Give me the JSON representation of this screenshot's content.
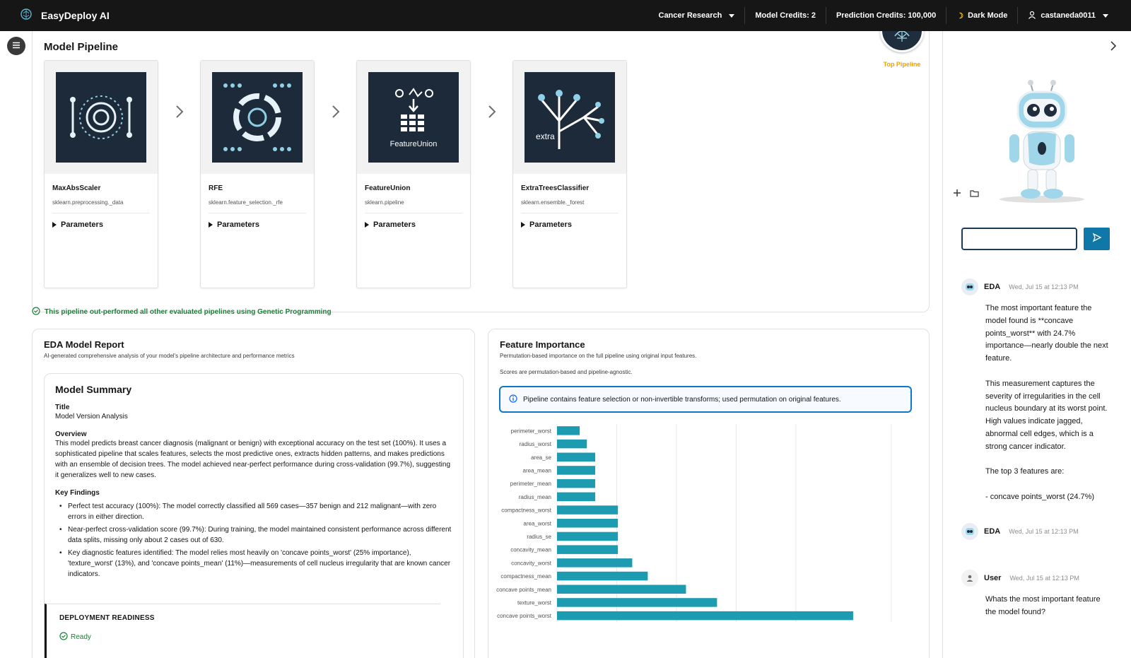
{
  "app": {
    "name": "EasyDeploy AI",
    "logo_icon": "brain-icon"
  },
  "topnav": {
    "project": "Cancer Research",
    "model_credits": "Model Credits: 2",
    "prediction_credits": "Prediction Credits: 100,000",
    "dark_mode": "Dark Mode",
    "user": "castaneda0011"
  },
  "pipeline": {
    "title": "Model Pipeline",
    "badge": "Top Pipeline",
    "steps": [
      {
        "name": "MaxAbsScaler",
        "module": "sklearn.preprocessing._data",
        "params_label": "Parameters",
        "art_text": ""
      },
      {
        "name": "RFE",
        "module": "sklearn.feature_selection._rfe",
        "params_label": "Parameters",
        "art_text": ""
      },
      {
        "name": "FeatureUnion",
        "module": "sklearn.pipeline",
        "params_label": "Parameters",
        "art_text": "FeatureUnion"
      },
      {
        "name": "ExtraTreesClassifier",
        "module": "sklearn.ensemble._forest",
        "params_label": "Parameters",
        "art_text": "extra"
      }
    ],
    "success_message": "This pipeline out-performed all other evaluated pipelines using Genetic Programming"
  },
  "eda_report": {
    "title": "EDA Model Report",
    "subtitle": "AI-generated comprehensive analysis of your model's pipeline architecture and performance metrics",
    "summary_title": "Model Summary",
    "title_label": "Title",
    "title_value": "Model Version Analysis",
    "overview_label": "Overview",
    "overview_text": "This model predicts breast cancer diagnosis (malignant or benign) with exceptional accuracy on the test set (100%). It uses a sophisticated pipeline that scales features, selects the most predictive ones, extracts hidden patterns, and makes predictions with an ensemble of decision trees. The model achieved near-perfect performance during cross-validation (99.7%), suggesting it generalizes well to new cases.",
    "findings_label": "Key Findings",
    "findings": [
      "Perfect test accuracy (100%): The model correctly classified all 569 cases—357 benign and 212 malignant—with zero errors in either direction.",
      "Near-perfect cross-validation score (99.7%): During training, the model maintained consistent performance across different data splits, missing only about 2 cases out of 630.",
      "Key diagnostic features identified: The model relies most heavily on 'concave points_worst' (25% importance), 'texture_worst' (13%), and 'concave points_mean' (11%)—measurements of cell nucleus irregularity that are known cancer indicators."
    ],
    "deployment_title": "DEPLOYMENT READINESS",
    "deployment_status": "Ready"
  },
  "feature_importance": {
    "title": "Feature Importance",
    "subtitle": "Permutation-based importance on the full pipeline using original input features.",
    "note": "Scores are permutation-based and pipeline-agnostic.",
    "info": "Pipeline contains feature selection or non-invertible transforms; used permutation on original features."
  },
  "chart_data": {
    "type": "bar",
    "orientation": "horizontal",
    "categories": [
      "perimeter_worst",
      "radius_worst",
      "area_se",
      "area_mean",
      "perimeter_mean",
      "radius_mean",
      "compactness_worst",
      "area_worst",
      "radius_se",
      "concavity_mean",
      "concavity_worst",
      "compactness_mean",
      "concave points_mean",
      "texture_worst",
      "concave points_worst"
    ],
    "values": [
      1.9,
      2.5,
      3.2,
      3.2,
      3.2,
      3.2,
      5.1,
      5.1,
      5.1,
      5.1,
      6.3,
      7.6,
      10.8,
      13.4,
      24.8
    ],
    "xticks": [
      "0%",
      "5%",
      "10%",
      "15%",
      "20%",
      "28%"
    ],
    "xlim": [
      0,
      28
    ],
    "bar_color": "#1d9bb0",
    "grid": true
  },
  "chat": {
    "messages": [
      {
        "author": "EDA",
        "time": "Wed, Jul 15 at 12:13 PM",
        "text": "The most important feature the model found is **concave points_worst** with 24.7% importance—nearly double the next feature.\n\nThis measurement captures the severity of irregularities in the cell nucleus boundary at its worst point. High values indicate jagged, abnormal cell edges, which is a strong cancer indicator.\n\nThe top 3 features are:\n\n- concave points_worst (24.7%)"
      },
      {
        "author": "EDA",
        "time": "Wed, Jul 15 at 12:13 PM",
        "text": ""
      },
      {
        "author": "User",
        "time": "Wed, Jul 15 at 12:13 PM",
        "text": "Whats the most important feature the model found?"
      }
    ]
  }
}
